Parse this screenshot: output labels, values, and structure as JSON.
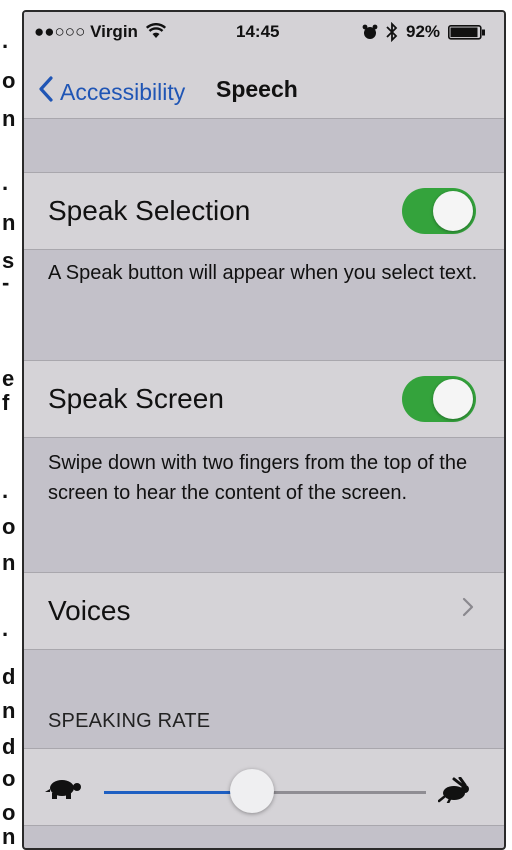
{
  "edge_chars": [
    ".",
    "o",
    "n",
    ".",
    "n",
    "s",
    "-",
    "e",
    "f",
    ".",
    "o",
    "n",
    ".",
    "d",
    "n",
    "d",
    "o",
    "o",
    "n"
  ],
  "status_bar": {
    "carrier": "●●○○○ Virgin",
    "time": "14:45",
    "battery": "92%"
  },
  "nav": {
    "back_label": "Accessibility",
    "title": "Speech"
  },
  "speak_selection": {
    "label": "Speak Selection",
    "enabled": true,
    "footer": "A Speak button will appear when you select text."
  },
  "speak_screen": {
    "label": "Speak Screen",
    "enabled": true,
    "footer": "Swipe down with two fingers from the top of the screen to hear the content of the screen."
  },
  "voices": {
    "label": "Voices"
  },
  "speaking_rate": {
    "header": "SPEAKING RATE",
    "value": 0.46
  },
  "colors": {
    "accent": "#1f55b5",
    "toggle_on": "#34a33c"
  },
  "icons": [
    "wifi-icon",
    "alarm-clock-icon",
    "bluetooth-icon",
    "battery-icon",
    "back-chevron-icon",
    "chevron-right-icon",
    "turtle-icon",
    "hare-icon"
  ]
}
